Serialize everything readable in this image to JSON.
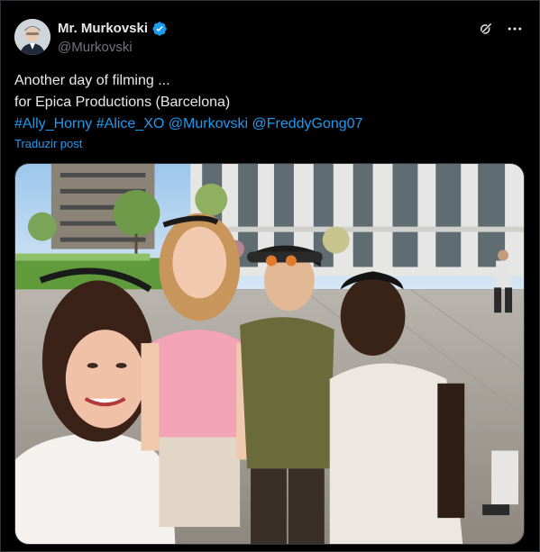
{
  "author": {
    "display_name": "Mr. Murkovski",
    "handle": "@Murkovski",
    "verified": true
  },
  "tweet": {
    "line1": "Another day of filming ...",
    "line2": "for Epica Productions (Barcelona)",
    "tags": [
      {
        "text": "#Ally_Horny"
      },
      {
        "text": "#Alice_XO"
      },
      {
        "text": "@Murkovski"
      },
      {
        "text": "@FreddyGong07"
      }
    ],
    "translate_label": "Traduzir post"
  },
  "media": {
    "description_icon": "photo"
  },
  "icons": {
    "verified": "verified-badge-icon",
    "grok": "grok-icon",
    "more": "more-icon"
  },
  "colors": {
    "background": "#000000",
    "text": "#e7e9ea",
    "secondary": "#71767b",
    "link": "#1d9bf0",
    "verified": "#1d9bf0"
  }
}
